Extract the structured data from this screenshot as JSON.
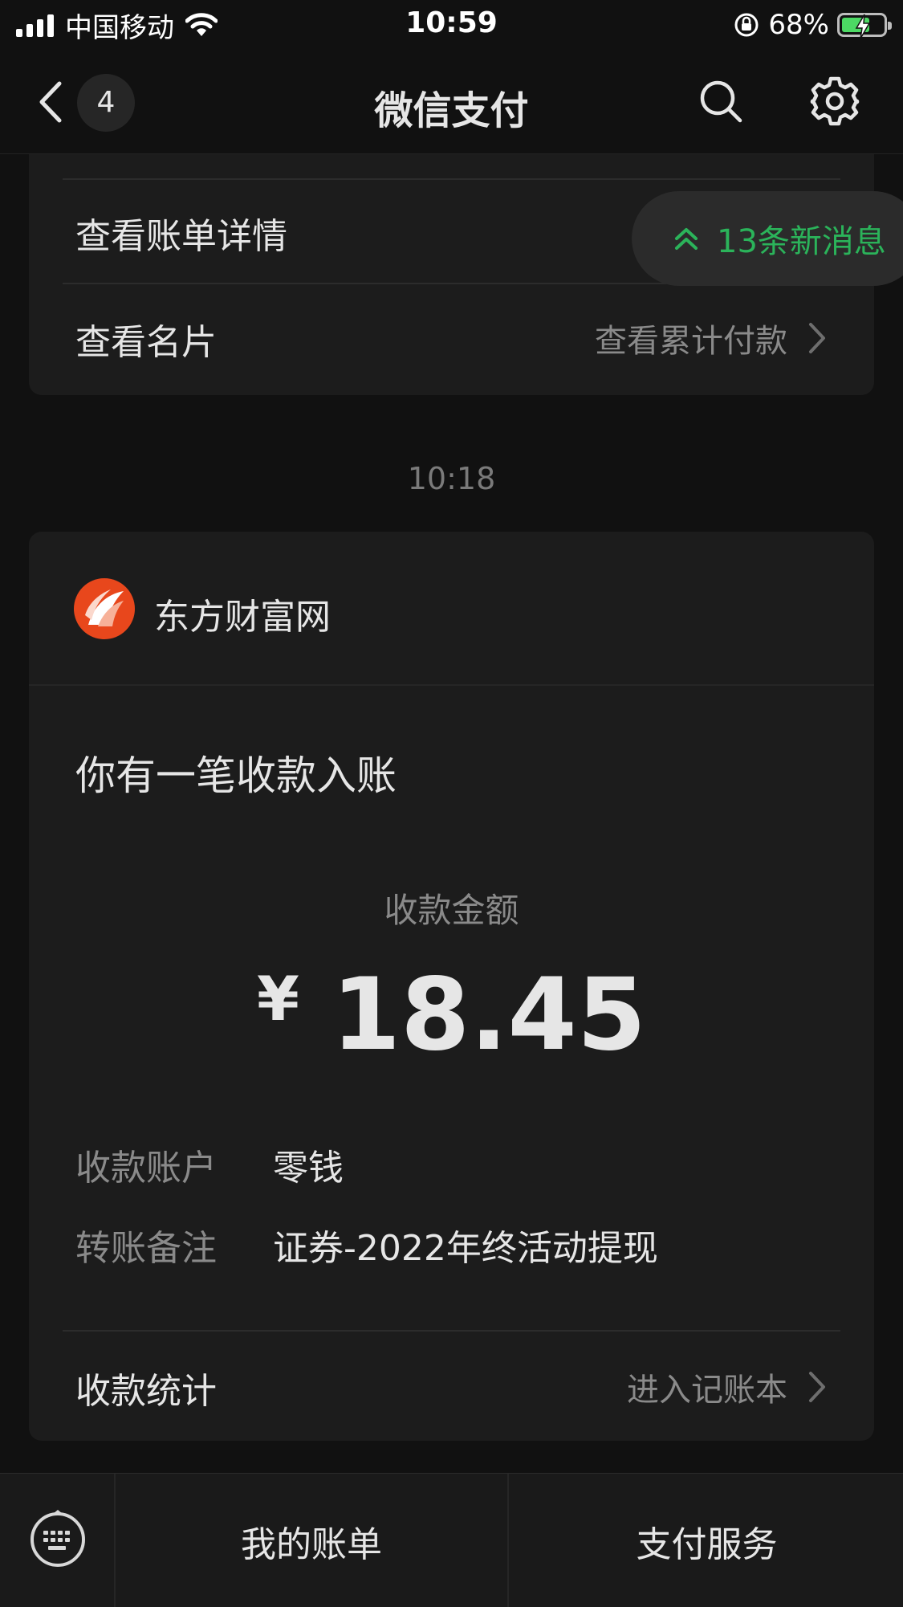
{
  "status_bar": {
    "carrier": "中国移动",
    "time": "10:59",
    "battery_percent": "68%",
    "battery_level": 0.68
  },
  "nav": {
    "unread_count": "4",
    "title": "微信支付"
  },
  "card1": {
    "row1_label": "查看账单详情",
    "row2_label": "查看名片",
    "row2_action": "查看累计付款"
  },
  "toast": {
    "text": "13条新消息"
  },
  "message": {
    "timestamp": "10:18",
    "merchant_name": "东方财富网",
    "title": "你有一笔收款入账",
    "amount_label": "收款金额",
    "currency": "¥",
    "amount": "18.45",
    "account_label": "收款账户",
    "account_value": "零钱",
    "remark_label": "转账备注",
    "remark_value": "证券-2022年终活动提现",
    "stats_label": "收款统计",
    "stats_action": "进入记账本"
  },
  "bottom_menu": {
    "item1": "我的账单",
    "item2": "支付服务"
  },
  "colors": {
    "background": "#111111",
    "card": "#1c1c1c",
    "accent_green": "#2bb35a",
    "battery_green": "#4cd964",
    "merchant_logo": "#e8471c"
  },
  "icons": [
    "wifi-icon",
    "rotation-lock-icon",
    "battery-icon",
    "back-arrow-icon",
    "search-icon",
    "gear-icon",
    "chevron-right-icon",
    "double-chevron-up-icon",
    "merchant-logo-icon",
    "keyboard-icon"
  ]
}
